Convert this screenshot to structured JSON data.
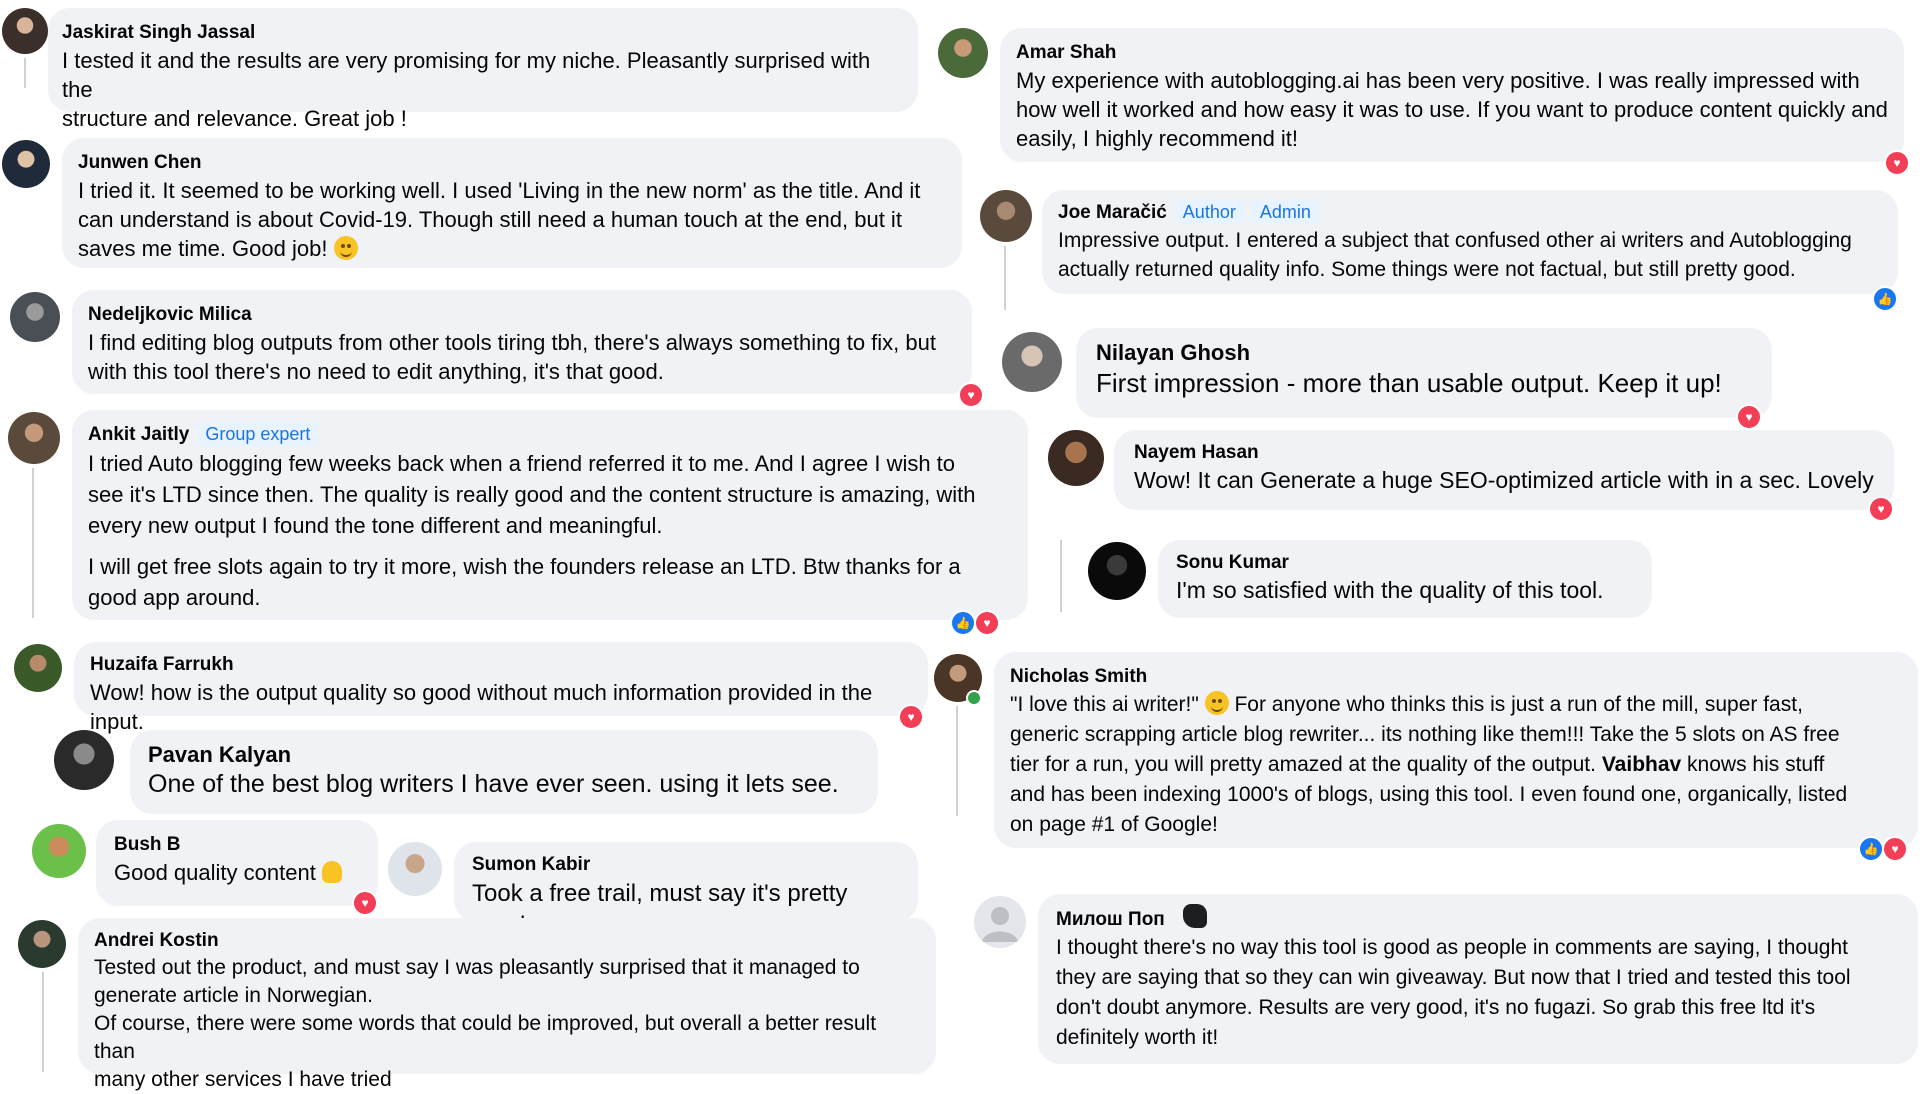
{
  "left": [
    {
      "name": "Jaskirat Singh Jassal",
      "lines": [
        "I tested it and the results are very promising for my niche. Pleasantly surprised with the",
        "structure and relevance. Great job !"
      ]
    },
    {
      "name": "Junwen Chen",
      "lines": [
        "I tried it. It seemed to be working well. I used 'Living in the new norm' as the title. And it",
        "can understand is about Covid-19. Though still need a human touch at the end, but it",
        "saves me time. Good job!"
      ]
    },
    {
      "name": "Nedeljkovic Milica",
      "lines": [
        "I find editing blog outputs from other tools tiring tbh, there's always something to fix, but",
        "with this tool there's no need to edit anything, it's that good."
      ]
    },
    {
      "name": "Ankit Jaitly",
      "badge": "Group expert",
      "lines": [
        "I tried Auto blogging few weeks back when a friend referred it to me. And I agree I wish to",
        "see it's LTD since then. The quality is really good and the content structure is amazing, with",
        "every new output I found the tone different and meaningful."
      ],
      "lines2": [
        "I will get free slots again to try it more, wish the founders release an LTD. Btw thanks for a",
        "good app around."
      ]
    },
    {
      "name": "Huzaifa Farrukh",
      "lines": [
        "Wow! how is the output quality so good without much information provided in the input."
      ]
    },
    {
      "name": "Pavan Kalyan",
      "lines": [
        "One of the best blog writers I have ever seen. using it lets see."
      ]
    },
    {
      "name": "Bush B",
      "lines": [
        "Good quality content"
      ]
    },
    {
      "name": "Sumon Kabir",
      "lines": [
        "Took a free trail, must say it's pretty good."
      ]
    },
    {
      "name": "Andrei Kostin",
      "lines": [
        "Tested out the product, and must say I was pleasantly surprised that it managed to",
        "generate article in Norwegian.",
        "Of course, there were some words that could be improved, but overall a better result than",
        "many other services I have tried"
      ]
    }
  ],
  "right": [
    {
      "name": "Amar Shah",
      "lines": [
        "My experience with autoblogging.ai has been very positive. I was really impressed with",
        "how well it worked and how easy it was to use. If you want to produce content quickly and",
        "easily, I highly recommend it!"
      ]
    },
    {
      "name": "Joe Maračić",
      "badges": [
        "Author",
        "Admin"
      ],
      "lines": [
        "Impressive output. I entered a subject that confused other ai writers and Autoblogging",
        "actually returned quality info. Some things were not factual, but still pretty good."
      ]
    },
    {
      "name": "Nilayan Ghosh",
      "lines": [
        "First impression - more than usable output. Keep it up!"
      ]
    },
    {
      "name": "Nayem Hasan",
      "lines": [
        "Wow! It can Generate a huge SEO-optimized article with in a sec. Lovely"
      ]
    },
    {
      "name": "Sonu Kumar",
      "lines": [
        "I'm so satisfied with the quality of this tool."
      ]
    },
    {
      "name": "Nicholas Smith",
      "line1": "\"I love this ai writer!\"",
      "line1b": " For anyone who thinks this is just a run of the mill, super fast,",
      "lines": [
        "generic scrapping article blog rewriter... its nothing like them!!! Take the 5 slots on AS free",
        "tier for a run, you will pretty amazed at the quality of the output."
      ],
      "bold": "Vaibhav",
      "line3b": " knows his stuff",
      "lines4": [
        "and has been indexing 1000's of blogs, using this tool. I even found one, organically, listed",
        "on page #1 of Google!"
      ]
    },
    {
      "name": "Милош Поп",
      "lines": [
        "I thought there's no way this tool is good as people in comments are saying, I thought",
        "they are saying that so they can win giveaway. But now that I tried and tested this tool",
        "don't doubt anymore. Results are very good, it's no fugazi. So grab this free ltd it's",
        "definitely worth it!"
      ]
    }
  ],
  "icons": {
    "reaction_love": "heart-icon",
    "reaction_like": "thumbs-up-icon",
    "wave": "waving-hand-icon",
    "ok_hand": "ok-hand-icon",
    "smile": "smile-emoji-icon",
    "wink": "wink-emoji-icon"
  },
  "colors": {
    "bubble": "#f0f2f5",
    "badge_bg": "#e7f3ff",
    "badge_text": "#1b74e4",
    "love": "#f33e58",
    "like": "#1877f2"
  }
}
